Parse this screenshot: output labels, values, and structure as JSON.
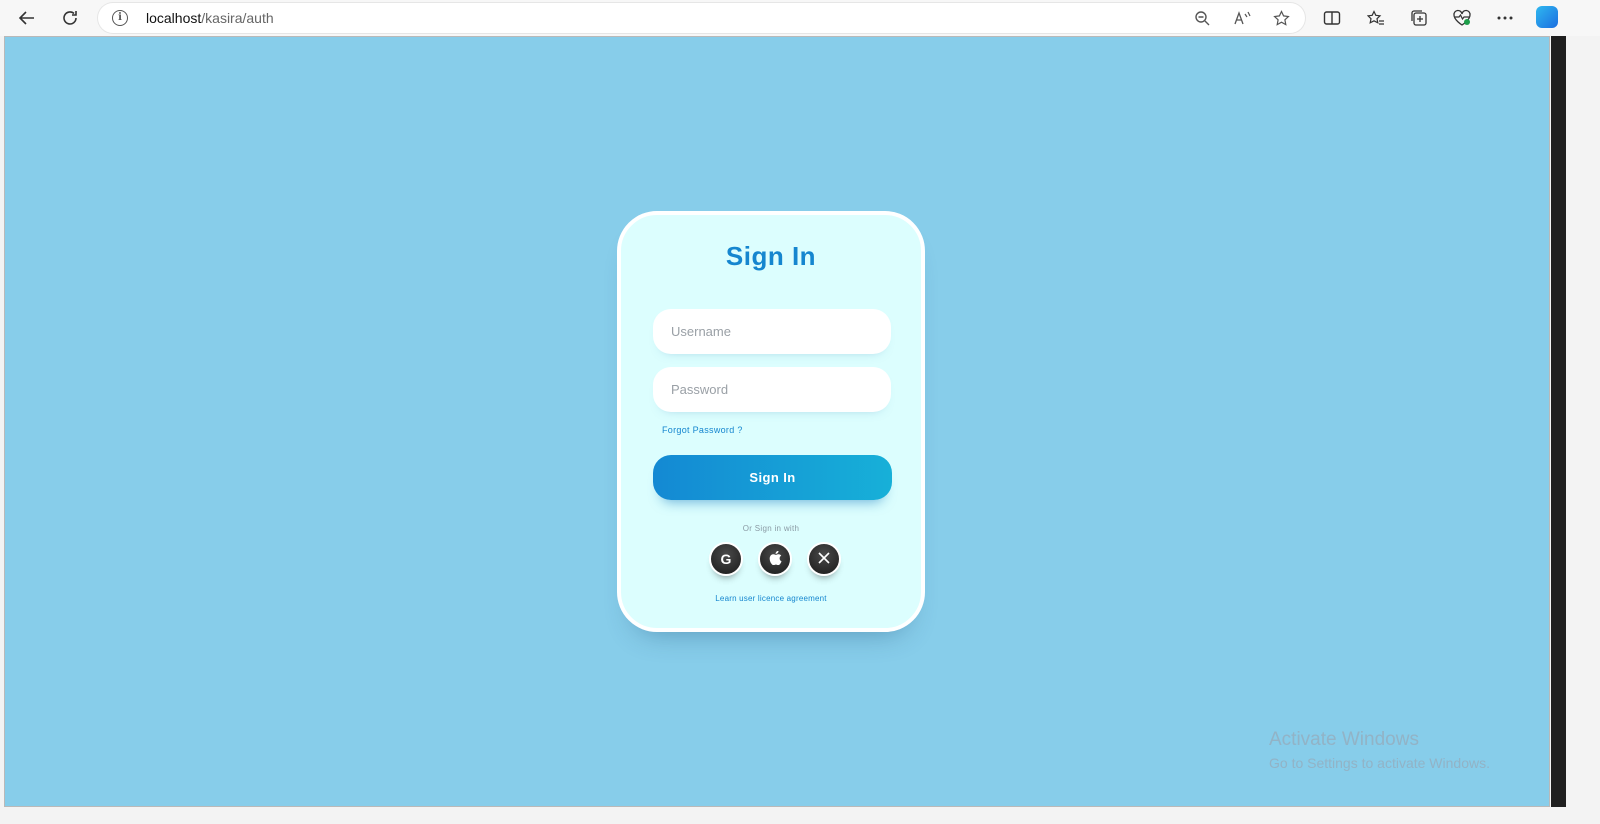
{
  "browser": {
    "url_host": "localhost",
    "url_path": "/kasira/auth",
    "icons": {
      "back": "back-arrow-icon",
      "refresh": "refresh-icon",
      "info": "info-icon",
      "zoom": "zoom-out-icon",
      "read_aloud": "read-aloud-icon",
      "favorite": "star-icon",
      "split": "split-screen-icon",
      "favorites": "favorites-icon",
      "collections": "collections-icon",
      "performance": "heart-pulse-icon",
      "more": "more-icon",
      "copilot": "copilot-icon"
    }
  },
  "card": {
    "title": "Sign In",
    "username_placeholder": "Username",
    "password_placeholder": "Password",
    "forgot_label": "Forgot Password ?",
    "signin_label": "Sign In",
    "or_text": "Or Sign in with",
    "social": [
      {
        "name": "google-icon",
        "glyph": "G"
      },
      {
        "name": "apple-icon",
        "glyph": ""
      },
      {
        "name": "x-icon",
        "glyph": "𝕏"
      }
    ],
    "licence_label": "Learn user licence agreement"
  },
  "watermark": {
    "title": "Activate Windows",
    "subtitle": "Go to Settings to activate Windows."
  },
  "colors": {
    "page_bg": "#87cdea",
    "card_bg": "#dcfefe",
    "accent": "#1586cf"
  }
}
